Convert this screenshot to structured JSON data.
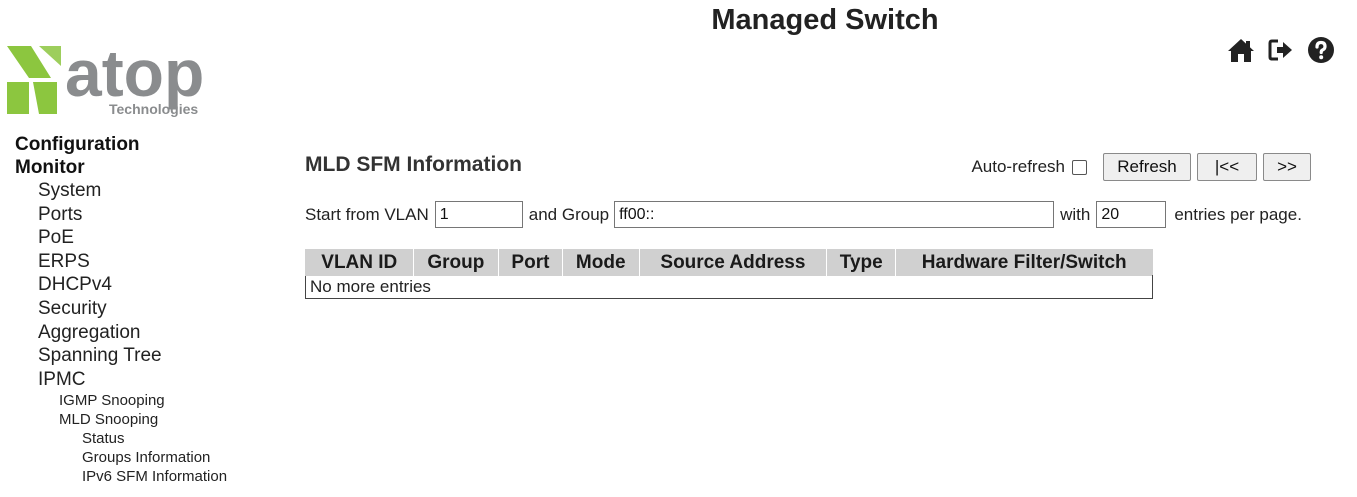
{
  "header": {
    "app_title": "Managed Switch",
    "logo": {
      "brand": "atop",
      "subtitle": "Technologies"
    },
    "icons": [
      "home-icon",
      "logout-icon",
      "help-icon"
    ]
  },
  "sidebar": {
    "configuration": "Configuration",
    "monitor": "Monitor",
    "items": [
      "System",
      "Ports",
      "PoE",
      "ERPS",
      "DHCPv4",
      "Security",
      "Aggregation",
      "Spanning Tree",
      "IPMC"
    ],
    "ipmc_children": [
      "IGMP Snooping",
      "MLD Snooping"
    ],
    "mld_children": [
      "Status",
      "Groups Information",
      "IPv6 SFM Information"
    ]
  },
  "main": {
    "title": "MLD SFM Information",
    "auto_refresh_label": "Auto-refresh",
    "auto_refresh_checked": false,
    "buttons": {
      "refresh": "Refresh",
      "first": "|<<",
      "next": ">>"
    },
    "filter": {
      "start_label": "Start from VLAN",
      "vlan_value": "1",
      "group_label": "and Group",
      "group_value": "ff00::",
      "with_label": "with",
      "entries_value": "20",
      "entries_suffix": "entries per page."
    },
    "table": {
      "columns": [
        "VLAN ID",
        "Group",
        "Port",
        "Mode",
        "Source Address",
        "Type",
        "Hardware Filter/Switch"
      ],
      "empty_message": "No more entries"
    }
  },
  "colors": {
    "logo_green": "#8cc63f",
    "logo_gray": "#8a8c8e",
    "table_header_bg": "#d0d0d0"
  }
}
